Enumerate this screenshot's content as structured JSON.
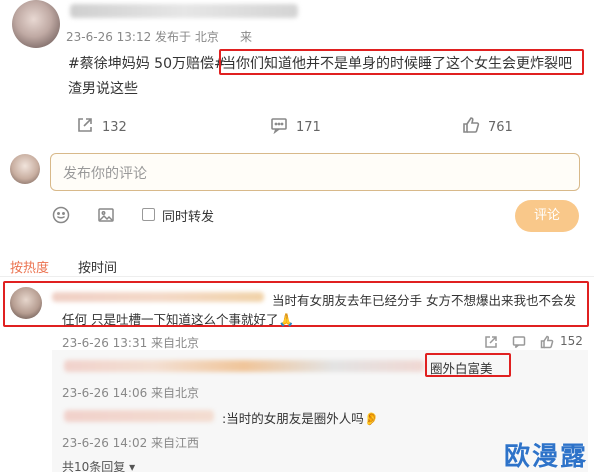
{
  "post": {
    "meta": "23-6-26 13:12 发布于 北京",
    "meta_tail": "来",
    "tags": "#蔡徐坤妈妈 50万赔偿#",
    "text_highlight": "当你们知道他并不是单身的时候睡了这个女生会更炸裂吧",
    "text_line2": "渣男说这些",
    "repost_count": "132",
    "comment_count": "171",
    "like_count": "761"
  },
  "composer": {
    "placeholder": "发布你的评论",
    "also_repost_label": "同时转发",
    "submit_label": "评论"
  },
  "sort_tabs": {
    "hot": "按热度",
    "time": "按时间"
  },
  "comments": [
    {
      "text_line1": "当时有女朋友去年已经分手 女方不想爆出来我也不会发",
      "text_line2": "任何 只是吐槽一下知道这么个事就好了🙏",
      "meta": "23-6-26 13:31 来自北京",
      "like_count": "152",
      "replies": [
        {
          "text": "圈外白富美",
          "meta": "23-6-26 14:06 来自北京"
        },
        {
          "text": ":当时的女朋友是圈外人吗👂",
          "meta": "23-6-26 14:02 来自江西"
        }
      ],
      "more_replies": "共10条回复 ▾"
    }
  ],
  "watermark": "欧漫露",
  "colors": {
    "accent": "#eb7350",
    "highlight_box": "#e02020",
    "watermark": "#2e73c9"
  }
}
